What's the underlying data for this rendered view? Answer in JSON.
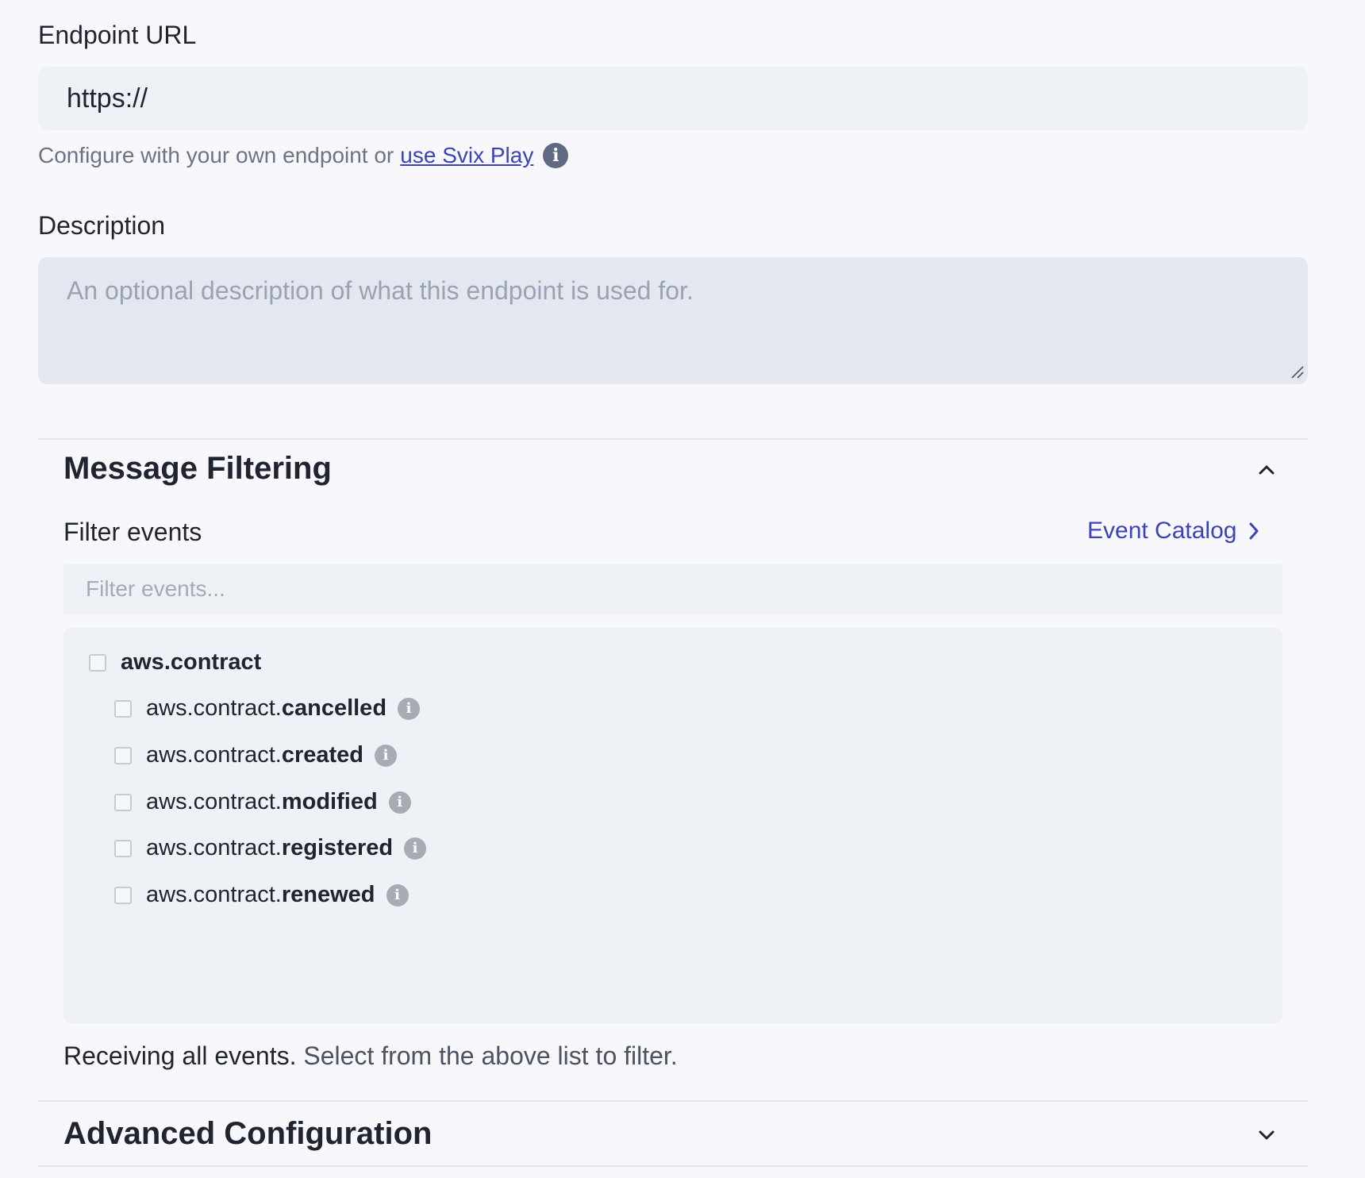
{
  "endpoint": {
    "label": "Endpoint URL",
    "value": "https://",
    "helper_text": "Configure with your own endpoint or",
    "helper_link": "use Svix Play"
  },
  "description": {
    "label": "Description",
    "placeholder": "An optional description of what this endpoint is used for."
  },
  "message_filtering": {
    "title": "Message Filtering",
    "expanded": true,
    "filter_label": "Filter events",
    "catalog_link": "Event Catalog",
    "search_placeholder": "Filter events...",
    "group": {
      "label": "aws.contract",
      "checked": false,
      "events": [
        {
          "prefix": "aws.contract.",
          "name": "cancelled",
          "checked": false
        },
        {
          "prefix": "aws.contract.",
          "name": "created",
          "checked": false
        },
        {
          "prefix": "aws.contract.",
          "name": "modified",
          "checked": false
        },
        {
          "prefix": "aws.contract.",
          "name": "registered",
          "checked": false
        },
        {
          "prefix": "aws.contract.",
          "name": "renewed",
          "checked": false
        }
      ]
    },
    "summary_strong": "Receiving all events.",
    "summary_rest": "Select from the above list to filter."
  },
  "advanced": {
    "title": "Advanced Configuration",
    "expanded": false
  },
  "icons": {
    "info": "info-icon",
    "chevron_up": "chevron-up-icon",
    "chevron_down": "chevron-down-icon",
    "chevron_right": "chevron-right-icon"
  },
  "colors": {
    "accent": "#3b43b8",
    "background": "#f8f8fc",
    "input_bg": "#eef1f6"
  }
}
